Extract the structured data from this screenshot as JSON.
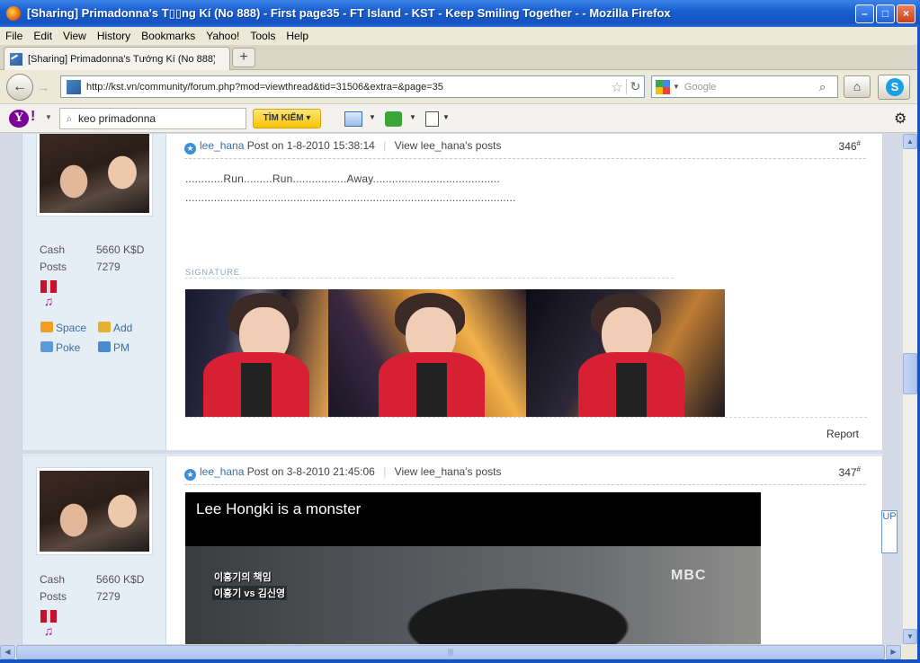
{
  "window": {
    "title": "[Sharing] Primadonna's T▯▯ng Kí (No 888) - First page35 - FT Island - KST - Keep Smiling Together - - Mozilla Firefox",
    "minimize": "–",
    "maximize": "□",
    "close": "×"
  },
  "menu": [
    "File",
    "Edit",
    "View",
    "History",
    "Bookmarks",
    "Yahoo!",
    "Tools",
    "Help"
  ],
  "tabs": [
    {
      "label": "[Sharing] Primadonna's Tướng Kí (No 888) - ...",
      "close": ""
    }
  ],
  "newtab_label": "+",
  "nav": {
    "back": "←",
    "forward": "→",
    "url": "http://kst.vn/community/forum.php?mod=viewthread&tid=31506&extra=&page=35",
    "bookmark_star": "☆",
    "reload": "↻",
    "search_placeholder": "Google",
    "search_icon": "⌕",
    "home": "⌂"
  },
  "yahoo": {
    "logo": "Y",
    "search_value": "keo primadonna",
    "search_button": "TÌM KIẾM ▾",
    "gear": "⚙"
  },
  "icons": {
    "firefox": "firefox-logo-icon",
    "site": "kst-favicon-icon",
    "google": "google-g-icon",
    "skype": "skype-icon",
    "yahoo": "yahoo-logo-icon",
    "mail": "mail-icon",
    "flower": "yahoo-widget-icon",
    "copy": "copy-icon",
    "space": "home-icon",
    "add": "add-friend-icon",
    "poke": "poke-icon",
    "pm": "envelope-icon"
  },
  "posts": [
    {
      "user": "lee_hana",
      "posted": "Post on 1-8-2010 15:38:14",
      "view_posts": "View lee_hana's posts",
      "number": "346",
      "number_suffix": "#",
      "cash_label": "Cash",
      "cash_value": "5660 K$D",
      "posts_label": "Posts",
      "posts_value": "7279",
      "space": "Space",
      "add": "Add",
      "poke": "Poke",
      "pm": "PM",
      "message_line1": "............Run.........Run.................Away........................................",
      "message_line2": "........................................................................................................",
      "signature_label": "SIGNATURE",
      "report": "Report"
    },
    {
      "user": "lee_hana",
      "posted": "Post on 3-8-2010 21:45:06",
      "view_posts": "View lee_hana's posts",
      "number": "347",
      "number_suffix": "#",
      "cash_label": "Cash",
      "cash_value": "5660 K$D",
      "posts_label": "Posts",
      "posts_value": "7279",
      "video_title": "Lee Hongki is a monster",
      "video_caption1": "이홍기의 책임",
      "video_caption2": "이홍기 vs 김신영",
      "video_logo": "MBC"
    }
  ],
  "up_button": "UP",
  "scroll": {
    "up": "▲",
    "down": "▼",
    "left": "◀",
    "right": "▶",
    "grip": "|||"
  }
}
